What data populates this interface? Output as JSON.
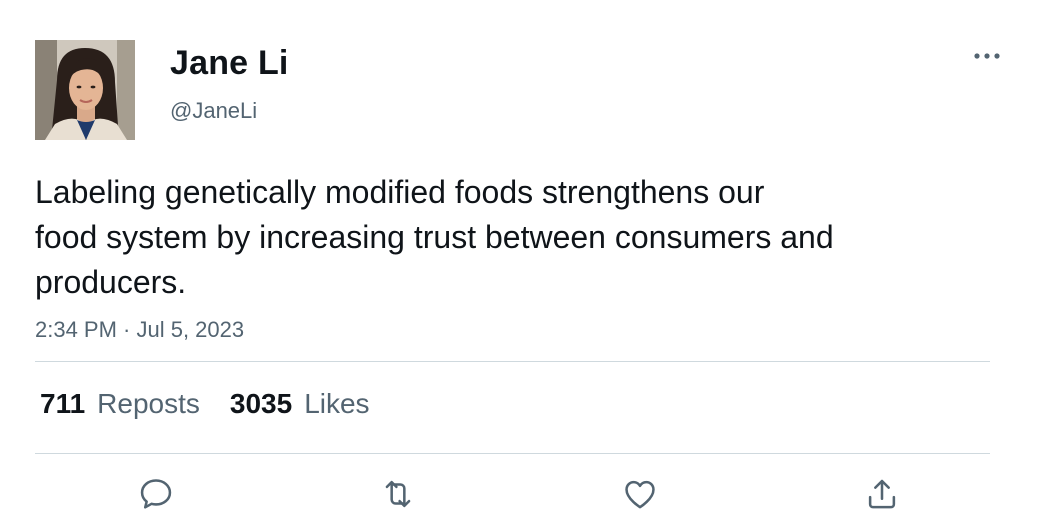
{
  "author": {
    "display_name": "Jane Li",
    "handle": "@JaneLi",
    "avatar_icon": "profile-photo"
  },
  "tweet": {
    "lines": [
      "Labeling genetically modified foods strengthens our",
      "food system by increasing trust between consumers and",
      "producers."
    ],
    "timestamp": "2:34 PM · Jul 5, 2023"
  },
  "stats": {
    "reposts_count": "711",
    "reposts_label": "Reposts",
    "likes_count": "3035",
    "likes_label": "Likes"
  },
  "actions": {
    "reply_icon": "reply-icon",
    "repost_icon": "repost-icon",
    "like_icon": "heart-icon",
    "share_icon": "share-icon",
    "more_icon": "more-icon"
  },
  "colors": {
    "text_primary": "#0f1419",
    "text_secondary": "#536471",
    "divider": "#cfd9de"
  }
}
